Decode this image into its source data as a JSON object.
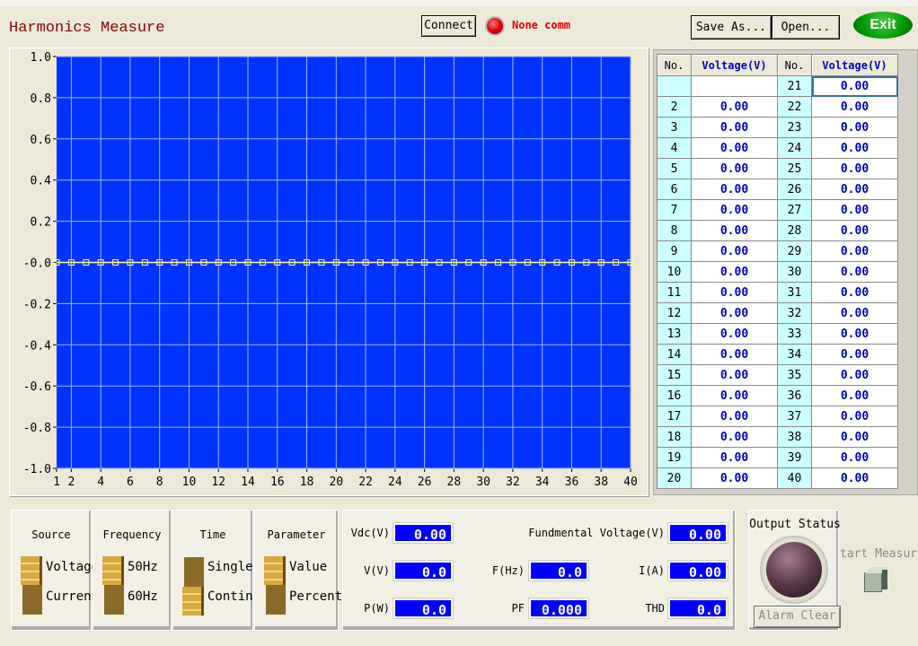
{
  "window": {
    "title": "Harmonics Measure"
  },
  "toolbar": {
    "connect_label": "Connect",
    "status_text": "None comm",
    "save_as_label": "Save As...",
    "open_label": "Open...",
    "exit_label": "Exit"
  },
  "chart_data": {
    "type": "line",
    "x": [
      1,
      2,
      3,
      4,
      5,
      6,
      7,
      8,
      9,
      10,
      11,
      12,
      13,
      14,
      15,
      16,
      17,
      18,
      19,
      20,
      21,
      22,
      23,
      24,
      25,
      26,
      27,
      28,
      29,
      30,
      31,
      32,
      33,
      34,
      35,
      36,
      37,
      38,
      39,
      40
    ],
    "values": [
      0,
      0,
      0,
      0,
      0,
      0,
      0,
      0,
      0,
      0,
      0,
      0,
      0,
      0,
      0,
      0,
      0,
      0,
      0,
      0,
      0,
      0,
      0,
      0,
      0,
      0,
      0,
      0,
      0,
      0,
      0,
      0,
      0,
      0,
      0,
      0,
      0,
      0,
      0,
      0
    ],
    "xlim": [
      1,
      40
    ],
    "ylim": [
      -1,
      1
    ],
    "xticks": [
      "1",
      "2",
      "4",
      "6",
      "8",
      "10",
      "12",
      "14",
      "16",
      "18",
      "20",
      "22",
      "24",
      "26",
      "28",
      "30",
      "32",
      "34",
      "36",
      "38",
      "40"
    ],
    "yticks": [
      "1.0",
      "0.8",
      "0.6",
      "0.4",
      "0.2",
      "-0.0",
      "-0.2",
      "-0.4",
      "-0.6",
      "-0.8",
      "-1.0"
    ],
    "grid": true,
    "colors": {
      "background": "#0033ff",
      "line": "#ffff99",
      "grid": "#a0b8ff"
    }
  },
  "table": {
    "headers": [
      "No.",
      "Voltage(V)",
      "No.",
      "Voltage(V)"
    ],
    "rows": [
      [
        "",
        "",
        "21",
        "0.00"
      ],
      [
        "2",
        "0.00",
        "22",
        "0.00"
      ],
      [
        "3",
        "0.00",
        "23",
        "0.00"
      ],
      [
        "4",
        "0.00",
        "24",
        "0.00"
      ],
      [
        "5",
        "0.00",
        "25",
        "0.00"
      ],
      [
        "6",
        "0.00",
        "26",
        "0.00"
      ],
      [
        "7",
        "0.00",
        "27",
        "0.00"
      ],
      [
        "8",
        "0.00",
        "28",
        "0.00"
      ],
      [
        "9",
        "0.00",
        "29",
        "0.00"
      ],
      [
        "10",
        "0.00",
        "30",
        "0.00"
      ],
      [
        "11",
        "0.00",
        "31",
        "0.00"
      ],
      [
        "12",
        "0.00",
        "32",
        "0.00"
      ],
      [
        "13",
        "0.00",
        "33",
        "0.00"
      ],
      [
        "14",
        "0.00",
        "34",
        "0.00"
      ],
      [
        "15",
        "0.00",
        "35",
        "0.00"
      ],
      [
        "16",
        "0.00",
        "36",
        "0.00"
      ],
      [
        "17",
        "0.00",
        "37",
        "0.00"
      ],
      [
        "18",
        "0.00",
        "38",
        "0.00"
      ],
      [
        "19",
        "0.00",
        "39",
        "0.00"
      ],
      [
        "20",
        "0.00",
        "40",
        "0.00"
      ]
    ]
  },
  "switches": [
    {
      "title": "Source",
      "options": [
        "Voltage",
        "Current"
      ],
      "selected": "Voltage"
    },
    {
      "title": "Frequency",
      "options": [
        "50Hz",
        "60Hz"
      ],
      "selected": "50Hz"
    },
    {
      "title": "Time",
      "options": [
        "Single",
        "Continu"
      ],
      "selected": "Continu"
    },
    {
      "title": "Parameter",
      "options": [
        "Value",
        "Percent"
      ],
      "selected": "Value"
    }
  ],
  "measurements": {
    "vdc": {
      "label": "Vdc(V)",
      "value": "0.00"
    },
    "v": {
      "label": "V(V)",
      "value": "0.0"
    },
    "p": {
      "label": "P(W)",
      "value": "0.0"
    },
    "fund": {
      "label": "Fundmental Voltage(V)",
      "value": "0.00"
    },
    "f": {
      "label": "F(Hz)",
      "value": "0.0"
    },
    "i": {
      "label": "I(A)",
      "value": "0.00"
    },
    "pf": {
      "label": "PF",
      "value": "0.000"
    },
    "thd": {
      "label": "THD",
      "value": "0.0"
    }
  },
  "output": {
    "title": "Output Status",
    "alarm_clear_label": "Alarm Clear",
    "start_measure_label": "tart Measur"
  }
}
